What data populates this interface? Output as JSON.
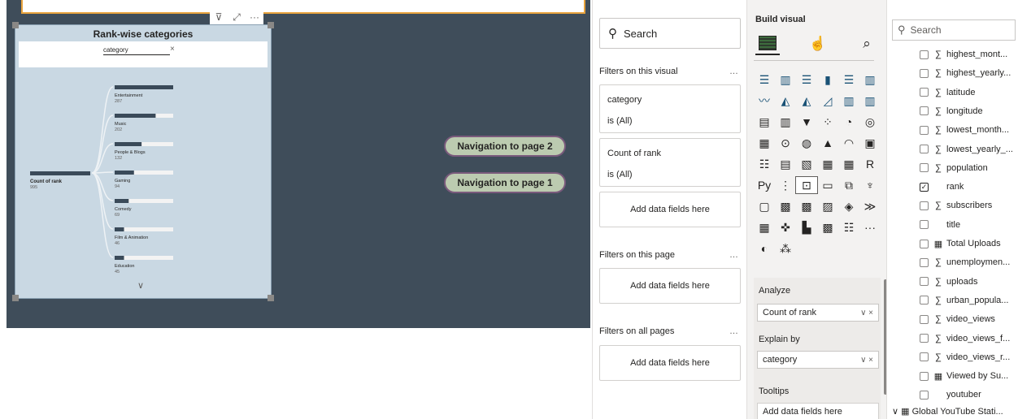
{
  "visual": {
    "title": "Rank-wise categories",
    "filter_label": "category",
    "filter_clear": "×",
    "root_name": "Count of rank",
    "root_value": "995",
    "root_fill": 1.0,
    "nodes": [
      {
        "name": "Entertainment",
        "value": "287",
        "fill": 1.0
      },
      {
        "name": "Music",
        "value": "202",
        "fill": 0.7
      },
      {
        "name": "People & Blogs",
        "value": "132",
        "fill": 0.46
      },
      {
        "name": "Gaming",
        "value": "94",
        "fill": 0.33
      },
      {
        "name": "Comedy",
        "value": "69",
        "fill": 0.24
      },
      {
        "name": "Film & Animation",
        "value": "46",
        "fill": 0.16
      },
      {
        "name": "Education",
        "value": "45",
        "fill": 0.16
      }
    ],
    "toolbar": {
      "filter_icon": "filter-icon",
      "focus_icon": "focus-mode-icon",
      "more": "···"
    }
  },
  "nav": {
    "page2": "Navigation to page 2",
    "page1": "Navigation to page 1"
  },
  "filters": {
    "search": "Search",
    "visual_heading": "Filters on this visual",
    "more": "…",
    "card1_title": "category",
    "card1_state": "is (All)",
    "card2_title": "Count of rank",
    "card2_state": "is (All)",
    "add": "Add data fields here",
    "page_heading": "Filters on this page",
    "all_heading": "Filters on all pages"
  },
  "viz": {
    "title": "Build visual",
    "analyze": "Analyze",
    "analyze_value": "Count of rank",
    "explain": "Explain by",
    "explain_value": "category",
    "tooltips": "Tooltips",
    "tooltips_add": "Add data fields here",
    "well_ctl": "∨ ×",
    "icons": [
      "stacked-bar-icon",
      "stacked-column-icon",
      "clustered-bar-icon",
      "clustered-column-icon",
      "100-bar-icon",
      "100-column-icon",
      "line-icon",
      "area-icon",
      "stacked-area-icon",
      "ribbon-icon",
      "line-column-icon",
      "line-clustered-icon",
      "waterfall-icon",
      "column-line-icon",
      "funnel-icon",
      "scatter-icon",
      "pie-icon",
      "donut-icon",
      "treemap-icon",
      "map-icon",
      "filled-map-icon",
      "azure-map-icon",
      "gauge-icon",
      "card-icon",
      "multirow-card-icon",
      "kpi-icon",
      "slicer-icon",
      "table-icon",
      "matrix-icon",
      "r-visual-icon",
      "python-icon",
      "key-influencers-icon",
      "decomposition-tree-icon",
      "qa-icon",
      "narrative-icon",
      "goals-icon",
      "paginated-icon",
      "power-apps-icon",
      "power-automate-icon",
      "sparkle-icon",
      "diamond-icon",
      "chevrons-icon",
      "arcgis-icon",
      "flow-icon",
      "bar-sunburst-icon",
      "grid-icon",
      "list-icon",
      "more-icon",
      "custom-visual-icon",
      "dots-icon"
    ],
    "glyphs": [
      "☰",
      "▥",
      "☰",
      "▮",
      "☰",
      "▥",
      "〰",
      "◭",
      "◭",
      "◿",
      "▥",
      "▥",
      "▤",
      "▥",
      "▼",
      "⁘",
      "◔",
      "◎",
      "▦",
      "⊙",
      "◍",
      "▲",
      "◠",
      "▣",
      "☷",
      "▤",
      "▧",
      "▦",
      "▦",
      "R",
      "Py",
      "⋮",
      "⊡",
      "▭",
      "⧉",
      "♆",
      "▢",
      "▩",
      "▩",
      "▨",
      "◈",
      "≫",
      "▦",
      "✜",
      "▙",
      "▩",
      "☷",
      "···",
      "◐",
      "⁂"
    ]
  },
  "data_pane": {
    "search": "Search",
    "fields": [
      {
        "name": "highest_mont...",
        "sigma": true,
        "checked": false,
        "kind": "sigma"
      },
      {
        "name": "highest_yearly...",
        "sigma": true,
        "checked": false,
        "kind": "sigma"
      },
      {
        "name": "latitude",
        "sigma": true,
        "checked": false,
        "kind": "sigma"
      },
      {
        "name": "longitude",
        "sigma": true,
        "checked": false,
        "kind": "sigma"
      },
      {
        "name": "lowest_month...",
        "sigma": true,
        "checked": false,
        "kind": "sigma"
      },
      {
        "name": "lowest_yearly_...",
        "sigma": true,
        "checked": false,
        "kind": "sigma"
      },
      {
        "name": "population",
        "sigma": true,
        "checked": false,
        "kind": "sigma"
      },
      {
        "name": "rank",
        "sigma": false,
        "checked": true,
        "kind": "none"
      },
      {
        "name": "subscribers",
        "sigma": true,
        "checked": false,
        "kind": "sigma"
      },
      {
        "name": "title",
        "sigma": false,
        "checked": false,
        "kind": "none"
      },
      {
        "name": "Total Uploads",
        "sigma": false,
        "checked": false,
        "kind": "calc"
      },
      {
        "name": "unemploymen...",
        "sigma": true,
        "checked": false,
        "kind": "sigma"
      },
      {
        "name": "uploads",
        "sigma": true,
        "checked": false,
        "kind": "sigma"
      },
      {
        "name": "urban_popula...",
        "sigma": true,
        "checked": false,
        "kind": "sigma"
      },
      {
        "name": "video_views",
        "sigma": true,
        "checked": false,
        "kind": "sigma"
      },
      {
        "name": "video_views_f...",
        "sigma": true,
        "checked": false,
        "kind": "sigma"
      },
      {
        "name": "video_views_r...",
        "sigma": true,
        "checked": false,
        "kind": "sigma"
      },
      {
        "name": "Viewed by Su...",
        "sigma": false,
        "checked": false,
        "kind": "calc"
      },
      {
        "name": "youtuber",
        "sigma": false,
        "checked": false,
        "kind": "none"
      }
    ],
    "table": "Global YouTube Stati...",
    "glyph_sigma": "∑",
    "glyph_calc": "▦",
    "glyph_check": "✓"
  },
  "colors": {
    "page_bg": "#3f4d5a",
    "visual_bg": "#c9d8e3",
    "bar_fill": "#3a4a59",
    "bar_track": "#f3f3f3",
    "nav_bg": "#bccbb0",
    "nav_border": "#7a5a7c",
    "selection": "#e8a33d"
  }
}
